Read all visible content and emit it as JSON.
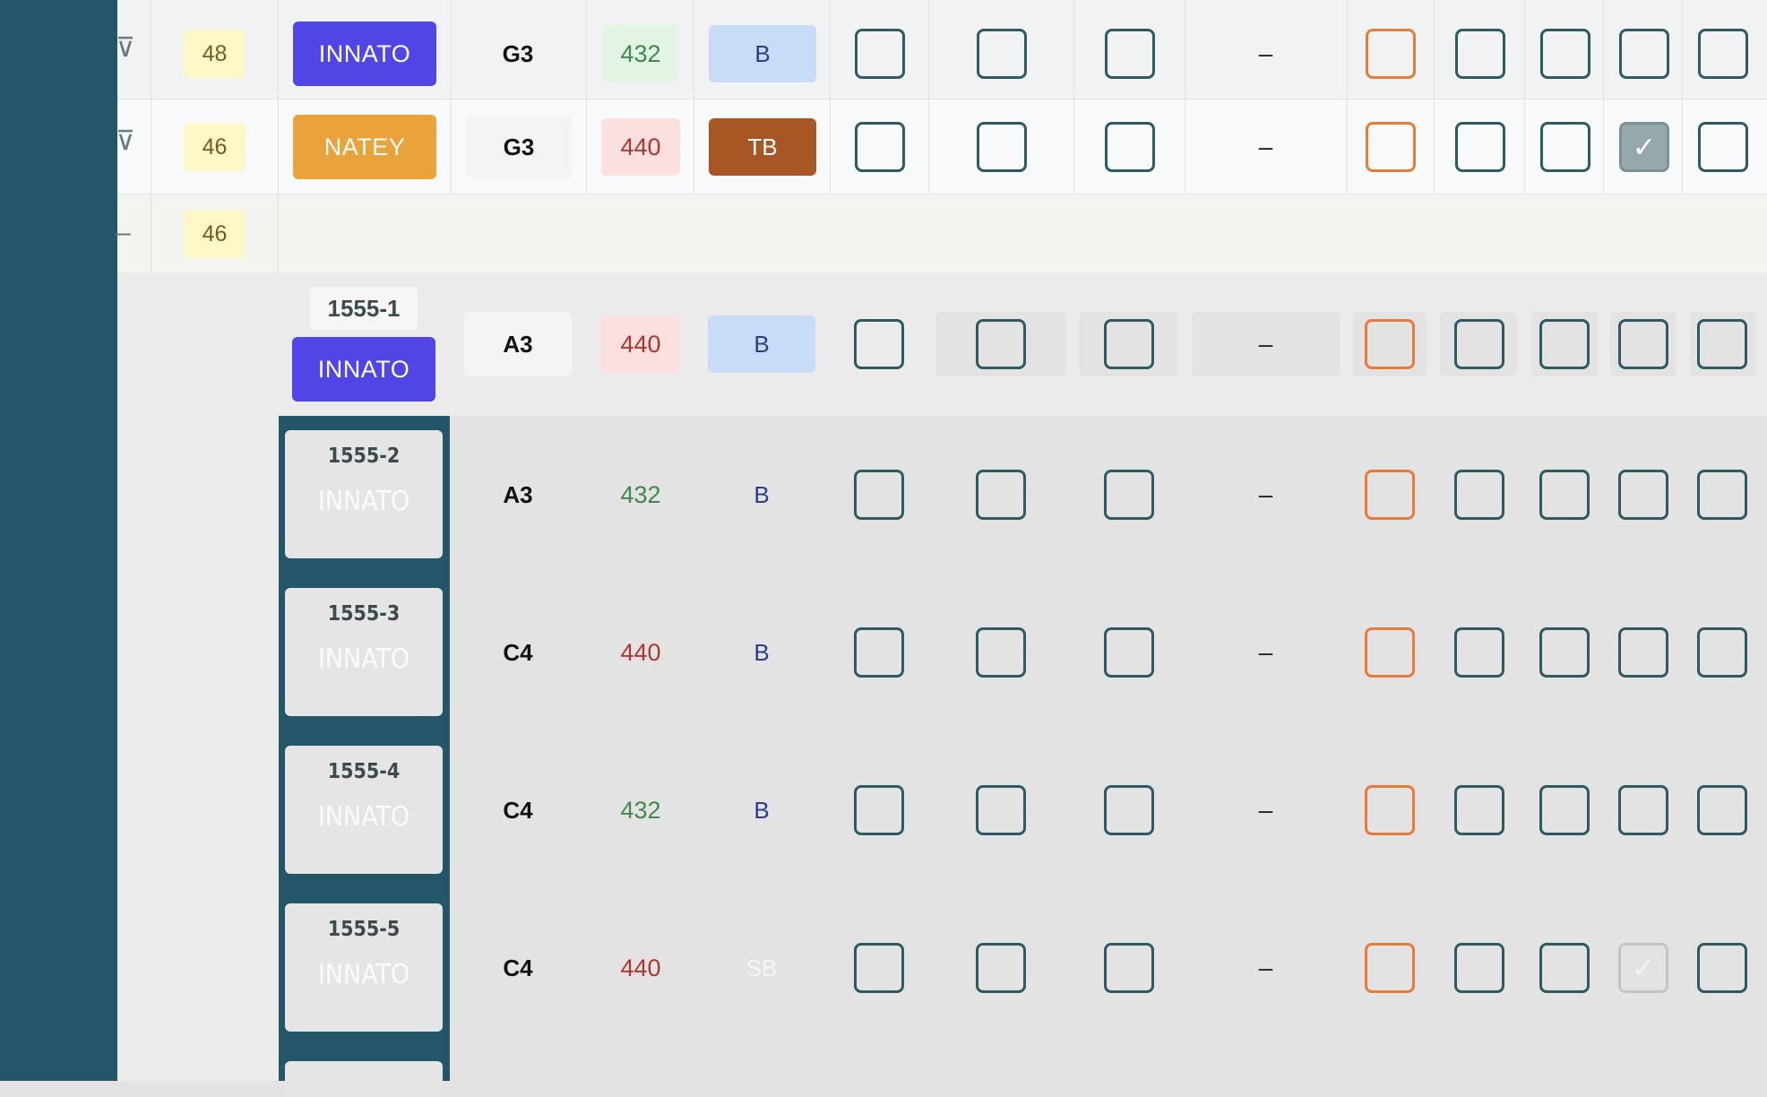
{
  "rows": [
    {
      "edge_icon": "filter-icon",
      "number": "48",
      "brand": "INNATO",
      "note": "G3",
      "tuning": "432",
      "type": "B",
      "dash": "–"
    },
    {
      "edge_icon": "filter-icon",
      "number": "46",
      "brand": "NATEY",
      "note": "G3",
      "tuning": "440",
      "type": "TB",
      "dash": "–"
    },
    {
      "edge_icon": "dash-icon",
      "number": "46"
    }
  ],
  "expanded": {
    "header": {
      "code": "1555-1",
      "brand": "INNATO",
      "note": "A3",
      "tuning": "440",
      "type": "B",
      "dash": "–"
    },
    "variants": [
      {
        "code": "1555-2",
        "brand": "INNATO",
        "note": "A3",
        "tuning": "432",
        "type": "B",
        "dash": "–"
      },
      {
        "code": "1555-3",
        "brand": "INNATO",
        "note": "C4",
        "tuning": "440",
        "type": "B",
        "dash": "–"
      },
      {
        "code": "1555-4",
        "brand": "INNATO",
        "note": "C4",
        "tuning": "432",
        "type": "B",
        "dash": "–"
      },
      {
        "code": "1555-5",
        "brand": "INNATO",
        "note": "C4",
        "tuning": "440",
        "type": "SB",
        "dash": "–"
      }
    ]
  },
  "icons": {
    "check": "✓"
  },
  "colors": {
    "teal": "#24566a",
    "innato": "#4f46e5",
    "natey": "#eaa23b",
    "orange_checkbox": "#e87b3a",
    "tb_badge": "#a85623"
  }
}
